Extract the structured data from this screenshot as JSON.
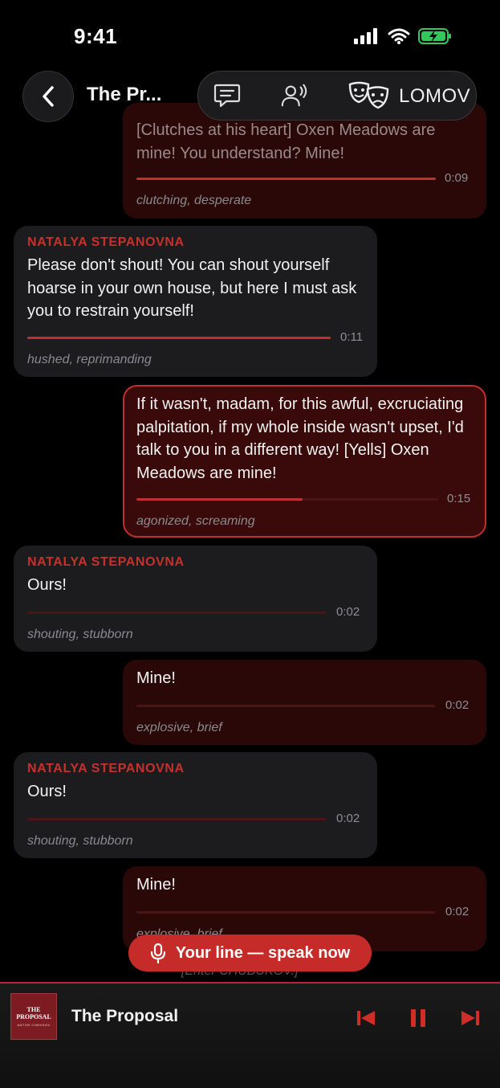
{
  "status": {
    "time": "9:41"
  },
  "header": {
    "title": "The Pr...",
    "role": "LOMOV"
  },
  "messages": [
    {
      "speaker": "",
      "text": "[Clutches at his heart] Oxen Meadows are mine! You understand? Mine!",
      "duration": "0:09",
      "emotion": "clutching, desperate",
      "progress": 1.0
    },
    {
      "speaker": "NATALYA STEPANOVNA",
      "text": "Please don't shout! You can shout yourself hoarse in your own house, but here I must ask you to restrain yourself!",
      "duration": "0:11",
      "emotion": "hushed, reprimanding",
      "progress": 1.0
    },
    {
      "speaker": "",
      "text": "If it wasn't, madam, for this awful, excruciating palpitation, if my whole inside wasn't upset, I'd talk to you in a different way! [Yells] Oxen Meadows are mine!",
      "duration": "0:15",
      "emotion": "agonized, screaming",
      "progress": 0.55
    },
    {
      "speaker": "NATALYA STEPANOVNA",
      "text": "Ours!",
      "duration": "0:02",
      "emotion": "shouting, stubborn",
      "progress": 0.0
    },
    {
      "speaker": "",
      "text": "Mine!",
      "duration": "0:02",
      "emotion": "explosive, brief",
      "progress": 0.0
    },
    {
      "speaker": "NATALYA STEPANOVNA",
      "text": "Ours!",
      "duration": "0:02",
      "emotion": "shouting, stubborn",
      "progress": 0.0
    },
    {
      "speaker": "",
      "text": "Mine!",
      "duration": "0:02",
      "emotion": "explosive, brief",
      "progress": 0.0
    }
  ],
  "stage_direction": "[Enter CHUBUKOV.]",
  "speak_button": {
    "label": "Your line — speak now"
  },
  "player": {
    "title": "The Proposal",
    "album_art_title": "THE PROPOSAL",
    "album_art_subtitle": "ANTON CHEKHOV"
  },
  "colors": {
    "accent": "#c42b29",
    "bubble_own": "#2a0808",
    "bubble_other": "#1c1c1e"
  }
}
